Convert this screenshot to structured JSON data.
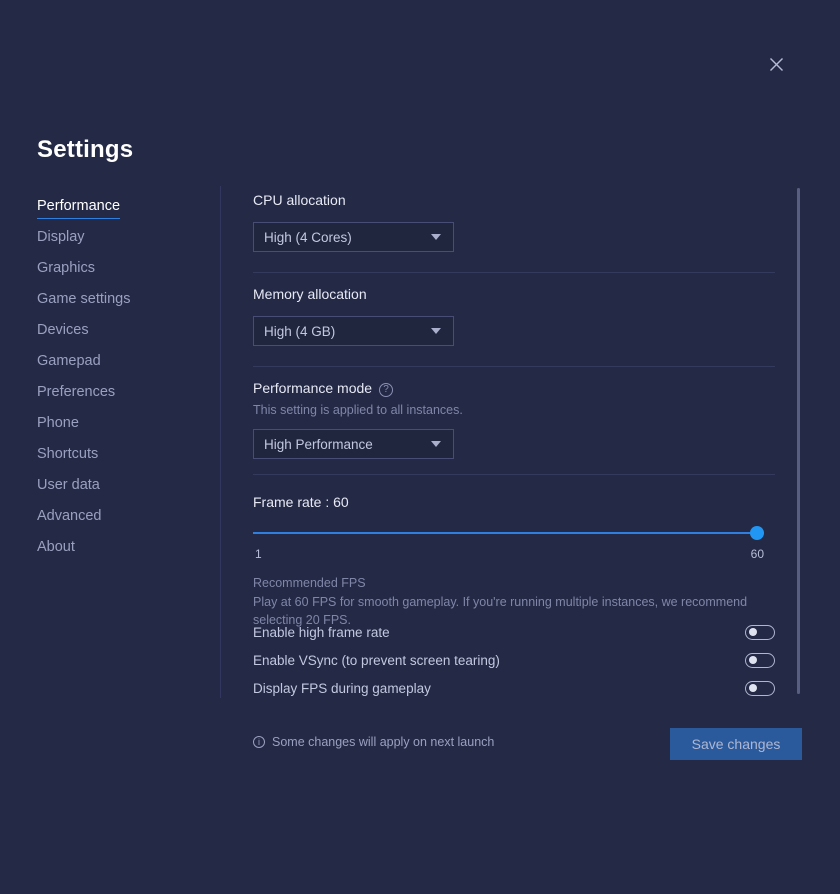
{
  "window": {
    "title": "Settings",
    "close_icon": "close-icon"
  },
  "sidebar": {
    "items": [
      {
        "label": "Performance",
        "active": true
      },
      {
        "label": "Display",
        "active": false
      },
      {
        "label": "Graphics",
        "active": false
      },
      {
        "label": "Game settings",
        "active": false
      },
      {
        "label": "Devices",
        "active": false
      },
      {
        "label": "Gamepad",
        "active": false
      },
      {
        "label": "Preferences",
        "active": false
      },
      {
        "label": "Phone",
        "active": false
      },
      {
        "label": "Shortcuts",
        "active": false
      },
      {
        "label": "User data",
        "active": false
      },
      {
        "label": "Advanced",
        "active": false
      },
      {
        "label": "About",
        "active": false
      }
    ]
  },
  "main": {
    "cpu": {
      "label": "CPU allocation",
      "value": "High (4 Cores)"
    },
    "memory": {
      "label": "Memory allocation",
      "value": "High (4 GB)"
    },
    "performance_mode": {
      "label": "Performance mode",
      "help_icon": "question-mark-icon",
      "help_glyph": "?",
      "sublabel": "This setting is applied to all instances.",
      "value": "High Performance"
    },
    "frame_rate": {
      "title": "Frame rate : 60",
      "value": 60,
      "min": 1,
      "max": 60,
      "min_label": "1",
      "max_label": "60",
      "recommended_title": "Recommended FPS",
      "recommended_body": "Play at 60 FPS for smooth gameplay. If you're running multiple instances, we recommend selecting 20 FPS."
    },
    "toggles": [
      {
        "label": "Enable high frame rate",
        "on": false
      },
      {
        "label": "Enable VSync (to prevent screen tearing)",
        "on": false
      },
      {
        "label": "Display FPS during gameplay",
        "on": false
      }
    ]
  },
  "footer": {
    "note": "Some changes will apply on next launch",
    "info_icon": "info-icon",
    "info_glyph": "i",
    "save_label": "Save changes"
  },
  "colors": {
    "background": "#242945",
    "accent": "#2f7fe0",
    "slider_thumb": "#2196f3",
    "save_button": "#2b5a9c",
    "text_primary": "#e7e9f5",
    "text_muted": "#7f86a8"
  }
}
